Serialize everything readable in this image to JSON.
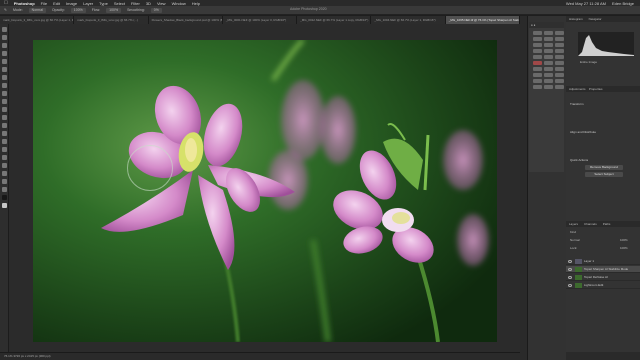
{
  "menubar": {
    "app": "Photoshop",
    "items": [
      "File",
      "Edit",
      "Image",
      "Layer",
      "Type",
      "Select",
      "Filter",
      "3D",
      "View",
      "Window",
      "Help"
    ],
    "datetime": "Wed May 27 11:28 AM",
    "user": "Eden Bridge"
  },
  "options": {
    "mode_label": "Mode:",
    "mode_value": "Normal",
    "opacity_label": "Opacity:",
    "opacity_value": "100%",
    "flow_label": "Flow:",
    "flow_value": "100%",
    "smoothing_label": "Smoothing:",
    "smoothing_value": "0%",
    "doc_title": "Adobe Photoshop 2020"
  },
  "tabs": [
    "mark_biopunk_3_IMG_xxxx.jpg @ 66.7% (Layer 1, RGB/8)",
    "mark_biopunk_3_IMG_xxxx.jpg @ 66.7% (...)",
    "Flowers_Shadow_Black_background.psd @ 100% (Backgr...",
    "_MG_0001.NEF @ 100% (Layer 0, RGB/16*)",
    "_MG_0012.NEF @ 66.7% (Layer 1 copy, RGB/16*)",
    "_MG_1004.NEF @ 66.7% (Layer 1, RGB/16*)",
    "_MG_1065.NEF.tif @ 76.1% (Topaz Sharpen AI Stabilize Mode, RGB/16*)"
  ],
  "active_tab_index": 6,
  "statusbar": {
    "text": "76.1%    3726 px x 2415 px (300 ppi)"
  },
  "histogram": {
    "tabs": [
      "Histogram",
      "Navigator"
    ],
    "channel": "Entire Image",
    "source_label": "Source:"
  },
  "properties": {
    "tabs": [
      "Adjustments",
      "Properties"
    ],
    "section_transform": "Transform",
    "section_align": "Align and Distribute",
    "section_quick": "Quick Actions",
    "buttons": [
      "Remove Background",
      "Select Subject"
    ]
  },
  "layers": {
    "tabs": [
      "Layers",
      "Channels",
      "Paths"
    ],
    "kind_label": "Kind",
    "blend": "Normal",
    "opacity_label": "Opacity:",
    "opacity_value": "100%",
    "fill_label": "Fill:",
    "fill_value": "100%",
    "lock_label": "Lock:",
    "items": [
      {
        "name": "Layer 1"
      },
      {
        "name": "Topaz Sharpen AI Stabilize Mode"
      },
      {
        "name": "Topaz DeNoise AI"
      },
      {
        "name": "Lightroom Edit"
      }
    ]
  },
  "colors": {
    "ui_dark": "#1e1e1e",
    "panel": "#333333",
    "accent_tab": "#505050",
    "petal": "#c27ab8",
    "foliage": "#2d6a26"
  }
}
